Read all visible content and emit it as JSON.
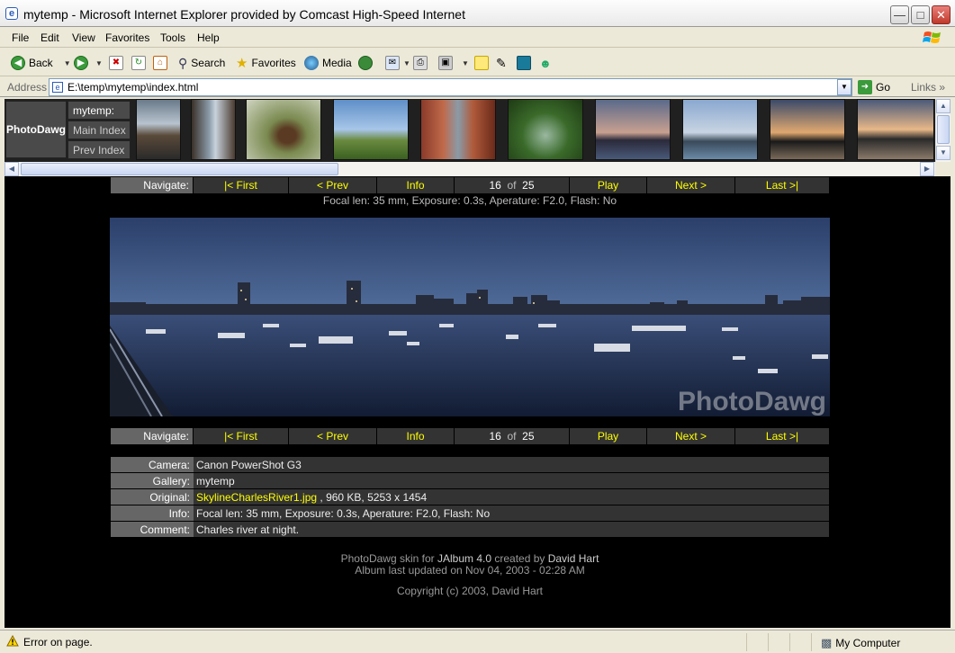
{
  "window": {
    "title": "mytemp - Microsoft Internet Explorer provided by Comcast High-Speed Internet"
  },
  "menu": [
    "File",
    "Edit",
    "View",
    "Favorites",
    "Tools",
    "Help"
  ],
  "toolbar": {
    "back_label": "Back",
    "search_label": "Search",
    "favorites_label": "Favorites",
    "media_label": "Media"
  },
  "address": {
    "label": "Address",
    "value": "E:\\temp\\mytemp\\index.html",
    "go_label": "Go",
    "links_label": "Links"
  },
  "index_frame": {
    "brand": "PhotoDawg",
    "gallery": "mytemp:",
    "main_index": "Main Index",
    "prev_index": "Prev Index"
  },
  "navigation": {
    "label": "Navigate:",
    "first": "|< First",
    "prev": "< Prev",
    "info": "Info",
    "current": "16",
    "of": "of",
    "total": "25",
    "play": "Play",
    "next": "Next >",
    "last": "Last >|"
  },
  "exif_line": "Focal len: 35 mm, Exposure: 0.3s, Aperature: F2.0, Flash: No",
  "watermark": "PhotoDawg",
  "details": {
    "camera_label": "Camera:",
    "camera": "Canon PowerShot G3",
    "gallery_label": "Gallery:",
    "gallery": "mytemp",
    "original_label": "Original:",
    "original_file": "SkylineCharlesRiver1.jpg",
    "original_meta": " , 960 KB,  5253 x 1454",
    "info_label": "Info:",
    "info": "Focal len: 35 mm, Exposure: 0.3s, Aperature: F2.0, Flash: No",
    "comment_label": "Comment:",
    "comment": "Charles river at night."
  },
  "footer": {
    "skin_pre": "PhotoDawg skin for ",
    "skin_app": "JAlbum 4.0",
    "skin_mid": " created by ",
    "skin_author": "David Hart",
    "updated": "Album last updated on Nov 04, 2003 - 02:28 AM",
    "copyright": "Copyright (c) 2003, David Hart"
  },
  "status": {
    "text": "Error on page.",
    "zone": "My Computer"
  },
  "colors": {
    "nav_link": "#ffff00",
    "cell_dark": "#333333",
    "cell_label": "#666666",
    "page_bg": "#000000"
  }
}
